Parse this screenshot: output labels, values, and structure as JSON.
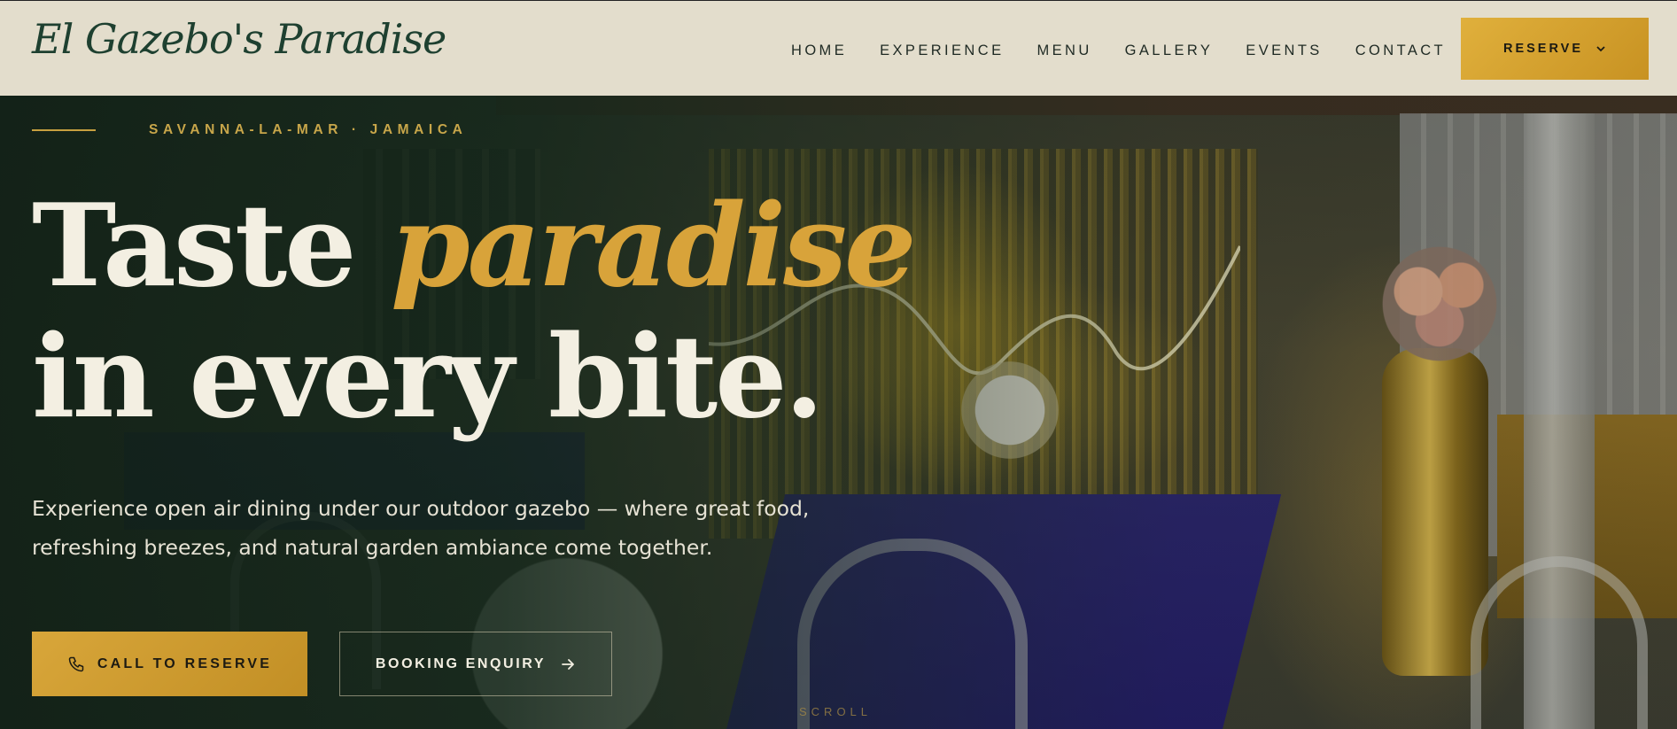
{
  "brand": {
    "logo_text": "El Gazebo's Paradise"
  },
  "nav": {
    "items": [
      {
        "label": "HOME"
      },
      {
        "label": "EXPERIENCE"
      },
      {
        "label": "MENU"
      },
      {
        "label": "GALLERY"
      },
      {
        "label": "EVENTS"
      },
      {
        "label": "CONTACT"
      }
    ],
    "reserve_label": "RESERVE",
    "reserve_icon": "chevron-down-icon"
  },
  "hero": {
    "eyebrow": "SAVANNA-LA-MAR · JAMAICA",
    "headline_part1": "Taste ",
    "headline_accent": "paradise",
    "headline_line2": "in every bite.",
    "lede": "Experience open air dining under our outdoor gazebo — where great food, refreshing breezes, and natural garden ambiance come together.",
    "primary_cta": {
      "label": "CALL TO RESERVE",
      "icon": "phone-icon"
    },
    "secondary_cta": {
      "label": "BOOKING ENQUIRY",
      "icon": "arrow-right-icon"
    },
    "scroll_hint": "SCROLL"
  },
  "colors": {
    "header_bg": "#e3ddcc",
    "brand_green": "#1e4030",
    "gold_accent": "#d8a33a",
    "headline_text": "#f3efe2"
  }
}
